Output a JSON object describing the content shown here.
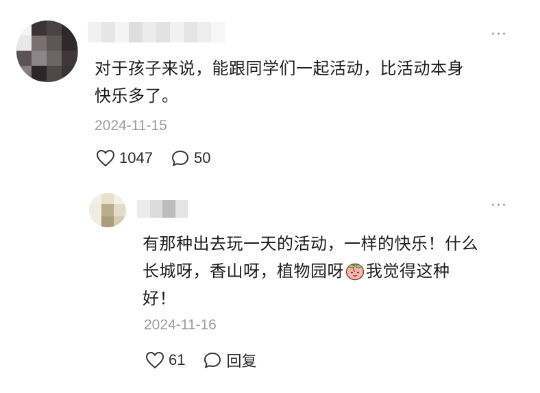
{
  "main_comment": {
    "avatar": "avatar-pixelated",
    "author": "",
    "text_line1": "对于孩子来说，能跟同学们一起活动，比活动本身",
    "text_line2": "快乐多了。",
    "date": "2024-11-15",
    "like_count": "1047",
    "reply_count": "50",
    "more_icon": "more-dots-icon"
  },
  "reply_comment": {
    "avatar": "avatar-pixelated",
    "author": "",
    "text_line1": "有那种出去玩一天的活动，一样的快乐！什么",
    "text_line2a": "长城呀，香山呀，植物园呀",
    "emoji": "peach-emoji",
    "text_line2b": "我觉得这种",
    "text_line3": "好！",
    "date": "2024-11-16",
    "like_count": "61",
    "reply_label": "回复",
    "more_icon": "more-dots-icon"
  },
  "colors": {
    "text": "#1b1b1b",
    "secondary_text": "#9c9c9c",
    "icon": "#333333",
    "background": "#ffffff"
  }
}
